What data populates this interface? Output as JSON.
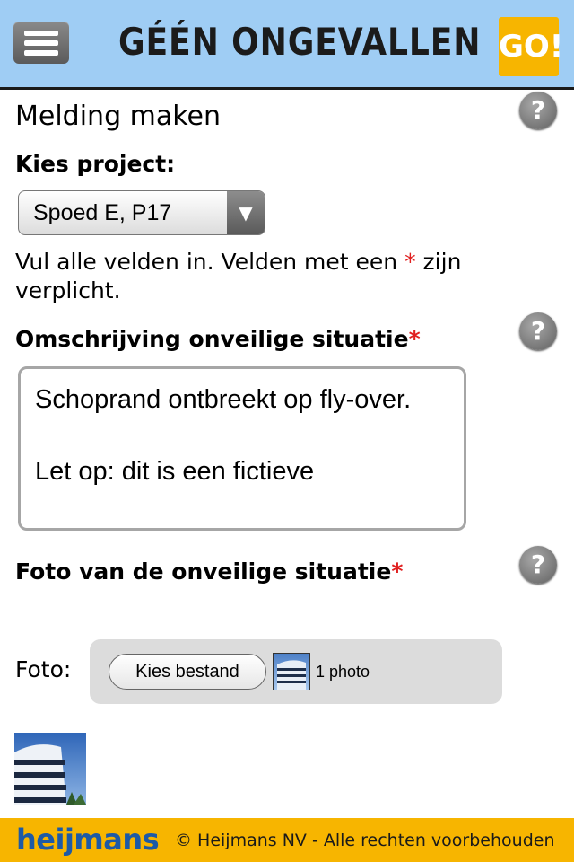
{
  "header": {
    "brand": "GÉÉN ONGEVALLEN",
    "go": "GO!",
    "menu_icon": "hamburger-menu-icon"
  },
  "page_title": "Melding maken",
  "help_label": "?",
  "project": {
    "label": "Kies project:",
    "selected": "Spoed E, P17"
  },
  "instructions": {
    "before": "Vul alle velden in. Velden met een ",
    "asterisk": "*",
    "after": " zijn verplicht."
  },
  "description": {
    "label": "Omschrijving onveilige situatie",
    "required_mark": "*",
    "value": "Schoprand ontbreekt op fly-over.\n\nLet op: dit is een fictieve"
  },
  "photo_section": {
    "label": "Foto van de onveilige situatie",
    "required_mark": "*",
    "field_label": "Foto:",
    "button_label": "Kies bestand",
    "file_count": "1 photo"
  },
  "footer": {
    "logo": "heijmans",
    "copyright": "© Heijmans NV - Alle rechten voorbehouden"
  },
  "colors": {
    "header_bg": "#9fcdf4",
    "footer_bg": "#f7b500",
    "go_bg": "#f7b500",
    "required": "#e02020",
    "logo": "#1d5aa6"
  }
}
